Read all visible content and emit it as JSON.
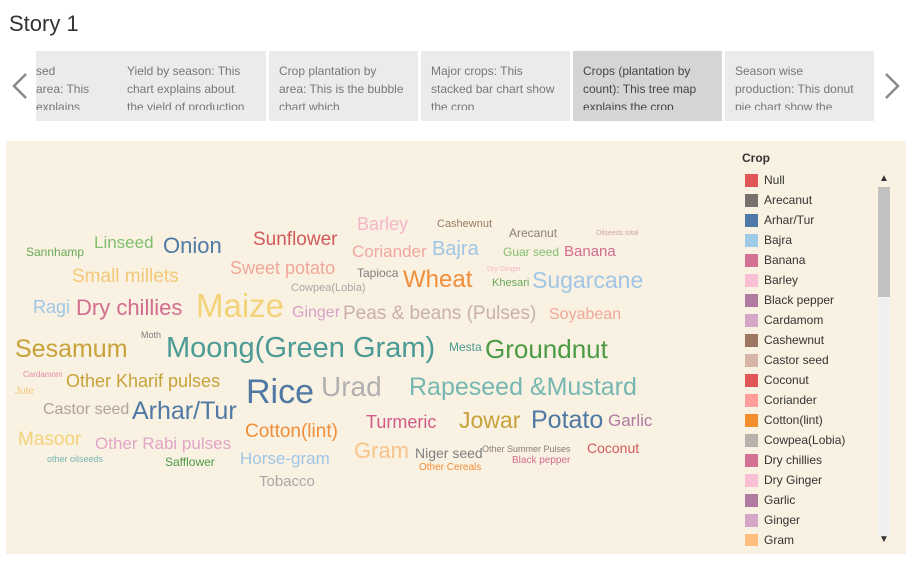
{
  "story": {
    "title": "Story 1"
  },
  "nav": {
    "prev_icon": "chevron-left-icon",
    "next_icon": "chevron-right-icon"
  },
  "story_points": [
    {
      "text": "sed\narea: This\nexplains",
      "active": false
    },
    {
      "text": "Yield by season: This chart explains about the yield of production",
      "active": false
    },
    {
      "text": "Crop plantation by area: This is the bubble chart which",
      "active": false
    },
    {
      "text": "Major crops: This stacked bar chart show the crop",
      "active": false
    },
    {
      "text": "Crops (plantation by count): This tree map explains the crop",
      "active": true
    },
    {
      "text": "Season wise production: This donut pie chart show the",
      "active": false
    }
  ],
  "word_cloud": {
    "words": [
      {
        "text": "Barley",
        "color": "#f3b6c8"
      },
      {
        "text": "Cashewnut",
        "color": "#9c7a66"
      },
      {
        "text": "Arecanut",
        "color": "#8b7d78"
      },
      {
        "text": "Oilseeds total",
        "color": "#d0a5a0"
      },
      {
        "text": "Linseed",
        "color": "#7fbf6e"
      },
      {
        "text": "Onion",
        "color": "#4f79a4"
      },
      {
        "text": "Sunflower",
        "color": "#d05b5b"
      },
      {
        "text": "Sannhamp",
        "color": "#6aaa5a"
      },
      {
        "text": "Coriander",
        "color": "#f0a7a0"
      },
      {
        "text": "Bajra",
        "color": "#9fc6e6"
      },
      {
        "text": "Guar seed",
        "color": "#80bf70"
      },
      {
        "text": "Banana",
        "color": "#d36c8f"
      },
      {
        "text": "Small millets",
        "color": "#f3c978"
      },
      {
        "text": "Sweet potato",
        "color": "#f1a799"
      },
      {
        "text": "Tapioca",
        "color": "#7f7f7f"
      },
      {
        "text": "Wheat",
        "color": "#f08e39"
      },
      {
        "text": "Dry Ginger",
        "color": "#f3b6c8"
      },
      {
        "text": "Khesari",
        "color": "#6aaa5a"
      },
      {
        "text": "Sugarcane",
        "color": "#9fc6e6"
      },
      {
        "text": "Cowpea(Lobia)",
        "color": "#a8a8a8"
      },
      {
        "text": "Ragi",
        "color": "#9fc6e6"
      },
      {
        "text": "Dry chillies",
        "color": "#d36c8f"
      },
      {
        "text": "Maize",
        "color": "#f3d37a"
      },
      {
        "text": "Ginger",
        "color": "#d8a1c8"
      },
      {
        "text": "Peas & beans (Pulses)",
        "color": "#c9b0a8"
      },
      {
        "text": "Soyabean",
        "color": "#f1a799"
      },
      {
        "text": "Moth",
        "color": "#7f7f7f"
      },
      {
        "text": "Sesamum",
        "color": "#c7a23a"
      },
      {
        "text": "Moong(Green Gram)",
        "color": "#4c9a96"
      },
      {
        "text": "Mesta",
        "color": "#4c9a96"
      },
      {
        "text": "Groundnut",
        "color": "#4c9a46"
      },
      {
        "text": "Cardamom",
        "color": "#e58ca8"
      },
      {
        "text": "Other Kharif pulses",
        "color": "#c7a23a"
      },
      {
        "text": "Rice",
        "color": "#4f79a4"
      },
      {
        "text": "Urad",
        "color": "#b0b0b0"
      },
      {
        "text": "Rapeseed &Mustard",
        "color": "#76b7b2"
      },
      {
        "text": "Jute",
        "color": "#f3c978"
      },
      {
        "text": "Castor seed",
        "color": "#b0a39c"
      },
      {
        "text": "Arhar/Tur",
        "color": "#4f79a4"
      },
      {
        "text": "Turmeric",
        "color": "#d05b8a"
      },
      {
        "text": "Jowar",
        "color": "#c7a23a"
      },
      {
        "text": "Potato",
        "color": "#4f79a4"
      },
      {
        "text": "Garlic",
        "color": "#b07aa1"
      },
      {
        "text": "Masoor",
        "color": "#f3d37a"
      },
      {
        "text": "Other Rabi pulses",
        "color": "#e0a5c8"
      },
      {
        "text": "Cotton(lint)",
        "color": "#f08e39"
      },
      {
        "text": "Gram",
        "color": "#f7c38b"
      },
      {
        "text": "Niger seed",
        "color": "#7f7f7f"
      },
      {
        "text": "Other Summer Pulses",
        "color": "#8b7d78"
      },
      {
        "text": "Coconut",
        "color": "#d05b5b"
      },
      {
        "text": "other oilseeds",
        "color": "#76b7b2"
      },
      {
        "text": "Safflower",
        "color": "#4c9a46"
      },
      {
        "text": "Horse-gram",
        "color": "#9fc6e6"
      },
      {
        "text": "Black pepper",
        "color": "#d36c8f"
      },
      {
        "text": "Other Cereals",
        "color": "#f08e39"
      },
      {
        "text": "Tobacco",
        "color": "#a8a8a8"
      }
    ]
  },
  "legend": {
    "title": "Crop",
    "items": [
      {
        "label": "Null",
        "color": "#e15759"
      },
      {
        "label": "Arecanut",
        "color": "#79706e"
      },
      {
        "label": "Arhar/Tur",
        "color": "#4e79a7"
      },
      {
        "label": "Bajra",
        "color": "#a0cbe8"
      },
      {
        "label": "Banana",
        "color": "#d37295"
      },
      {
        "label": "Barley",
        "color": "#fabfd2"
      },
      {
        "label": "Black pepper",
        "color": "#b07aa1"
      },
      {
        "label": "Cardamom",
        "color": "#d4a6c8"
      },
      {
        "label": "Cashewnut",
        "color": "#9d7660"
      },
      {
        "label": "Castor seed",
        "color": "#d7b5a6"
      },
      {
        "label": "Coconut",
        "color": "#e15759"
      },
      {
        "label": "Coriander",
        "color": "#ff9d9a"
      },
      {
        "label": "Cotton(lint)",
        "color": "#f28e2b"
      },
      {
        "label": "Cowpea(Lobia)",
        "color": "#bab0ac"
      },
      {
        "label": "Dry chillies",
        "color": "#d37295"
      },
      {
        "label": "Dry Ginger",
        "color": "#fabfd2"
      },
      {
        "label": "Garlic",
        "color": "#b07aa1"
      },
      {
        "label": "Ginger",
        "color": "#d4a6c8"
      },
      {
        "label": "Gram",
        "color": "#ffbe7d"
      }
    ]
  },
  "scrollbar": {
    "up_icon": "scroll-up-icon",
    "down_icon": "scroll-down-icon"
  }
}
